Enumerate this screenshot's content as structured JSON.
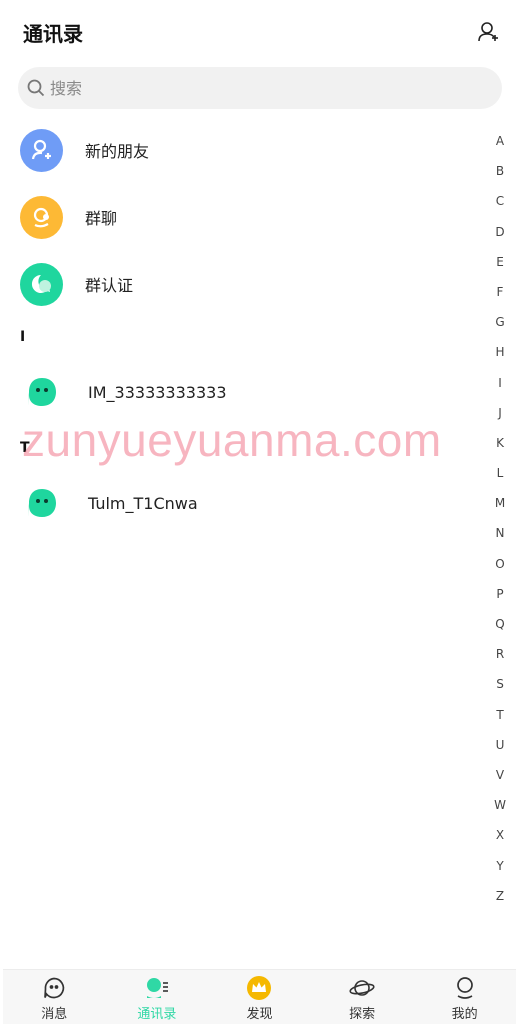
{
  "header": {
    "title": "通讯录"
  },
  "search": {
    "placeholder": "搜索"
  },
  "menu": [
    {
      "label": "新的朋友",
      "color": "#6f9cf6",
      "icon": "user-plus-icon"
    },
    {
      "label": "群聊",
      "color": "#fdb935",
      "icon": "group-chat-icon"
    },
    {
      "label": "群认证",
      "color": "#1fd69e",
      "icon": "group-verify-icon"
    }
  ],
  "sections": [
    {
      "letter": "I",
      "contacts": [
        {
          "name": "IM_33333333333"
        }
      ]
    },
    {
      "letter": "T",
      "contacts": [
        {
          "name": "Tulm_T1Cnwa"
        }
      ]
    }
  ],
  "watermark": "zunyueyuanma.com",
  "alpha_index": [
    "A",
    "B",
    "C",
    "D",
    "E",
    "F",
    "G",
    "H",
    "I",
    "J",
    "K",
    "L",
    "M",
    "N",
    "O",
    "P",
    "Q",
    "R",
    "S",
    "T",
    "U",
    "V",
    "W",
    "X",
    "Y",
    "Z"
  ],
  "tabs": [
    {
      "label": "消息",
      "icon": "chat-bubble-icon",
      "active": false
    },
    {
      "label": "通讯录",
      "icon": "contacts-icon",
      "active": true
    },
    {
      "label": "发现",
      "icon": "crown-icon",
      "active": false
    },
    {
      "label": "探索",
      "icon": "planet-icon",
      "active": false
    },
    {
      "label": "我的",
      "icon": "profile-icon",
      "active": false
    }
  ],
  "colors": {
    "accent": "#2fd8a5",
    "avatar": "#1fd69e"
  }
}
